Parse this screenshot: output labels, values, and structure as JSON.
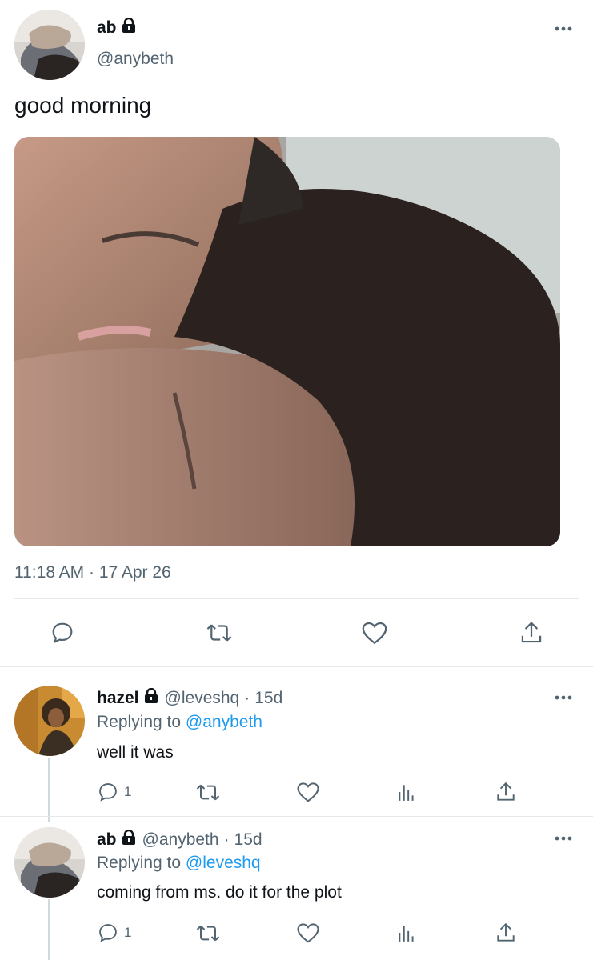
{
  "main_tweet": {
    "name": "ab",
    "handle": "@anybeth",
    "text": "good morning",
    "timestamp": "11:18 AM · 17 Apr 26"
  },
  "replies": [
    {
      "name": "hazel",
      "handle": "@leveshq",
      "age": "15d",
      "replying_prefix": "Replying to",
      "replying_to": "@anybeth",
      "text": "well it was",
      "reply_count": "1"
    },
    {
      "name": "ab",
      "handle": "@anybeth",
      "age": "15d",
      "replying_prefix": "Replying to",
      "replying_to": "@leveshq",
      "text": "coming from ms. do it for the plot",
      "reply_count": "1"
    }
  ],
  "icons": [
    "more-icon",
    "lock-icon",
    "reply-icon",
    "retweet-icon",
    "like-icon",
    "analytics-icon",
    "share-icon"
  ],
  "colors": {
    "link": "#1d9bf0",
    "secondary": "#536471",
    "divider": "#e6e9ec"
  }
}
